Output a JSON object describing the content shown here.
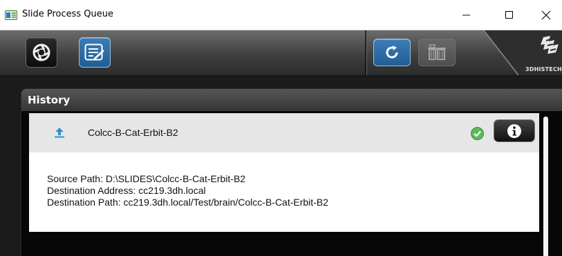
{
  "window": {
    "title": "Slide Process Queue",
    "controls": [
      "minimize",
      "maximize",
      "close"
    ]
  },
  "toolbar": {
    "left_buttons": [
      {
        "icon": "aperture-icon",
        "state": "normal"
      },
      {
        "icon": "edit-list-icon",
        "state": "active"
      }
    ],
    "right_buttons": [
      {
        "icon": "refresh-icon",
        "state": "active"
      },
      {
        "icon": "trash-icon",
        "state": "disabled"
      }
    ],
    "brand": "3DHISTECH"
  },
  "history": {
    "title": "History",
    "entries": [
      {
        "name": "Colcc-B-Cat-Erbit-B2",
        "type_icon": "upload-icon",
        "status_icon": "checkmark-icon",
        "status_color": "#5cb85c",
        "details": [
          "Source Path: D:\\SLIDES\\Colcc-B-Cat-Erbit-B2",
          "Destination Address: cc219.3dh.local",
          "Destination Path: cc219.3dh.local/Test/brain/Colcc-B-Cat-Erbit-B2"
        ]
      }
    ]
  },
  "colors": {
    "accent_blue": "#2a6aa3",
    "toolbar_dark": "#3f3f3f",
    "panel_bg": "#070707"
  }
}
